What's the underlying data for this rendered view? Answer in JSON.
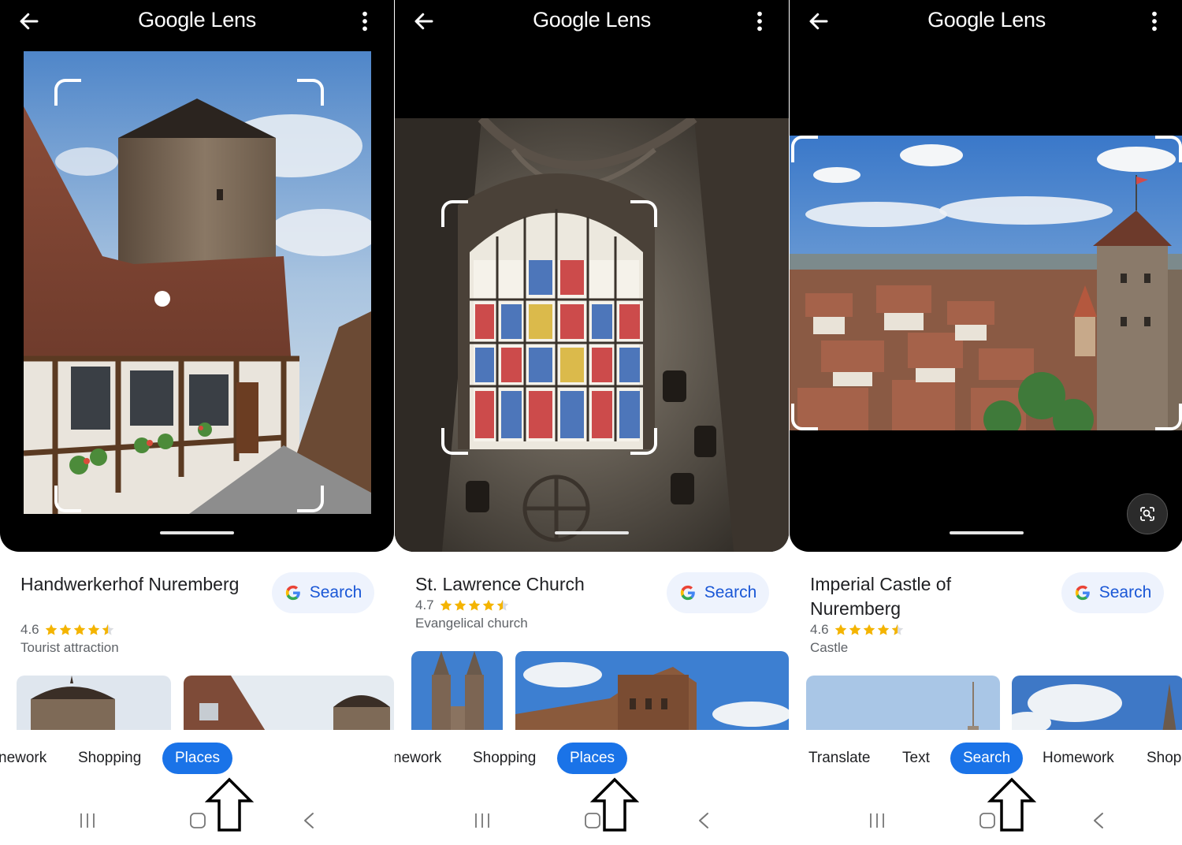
{
  "app_title": "Google Lens",
  "search_label": "Search",
  "nav_labels": {
    "recents": "|||"
  },
  "colors": {
    "accent": "#1a73e8",
    "search_text": "#1a57d6",
    "star": "#f4b400",
    "viewer_bg": "#000000"
  },
  "panels": [
    {
      "title": "Handwerkerhof Nuremberg",
      "rating": "4.6",
      "rating_value": 4.6,
      "category": "Tourist attraction",
      "tabs": [
        "nework",
        "Shopping",
        "Places"
      ],
      "active_tab": "Places"
    },
    {
      "title": "St. Lawrence Church",
      "rating": "4.7",
      "rating_value": 4.7,
      "category": "Evangelical church",
      "tabs": [
        "nework",
        "Shopping",
        "Places"
      ],
      "active_tab": "Places"
    },
    {
      "title": "Imperial Castle of Nuremberg",
      "rating": "4.6",
      "rating_value": 4.6,
      "category": "Castle",
      "tabs": [
        "Translate",
        "Text",
        "Search",
        "Homework",
        "Shop"
      ],
      "active_tab": "Search"
    }
  ]
}
